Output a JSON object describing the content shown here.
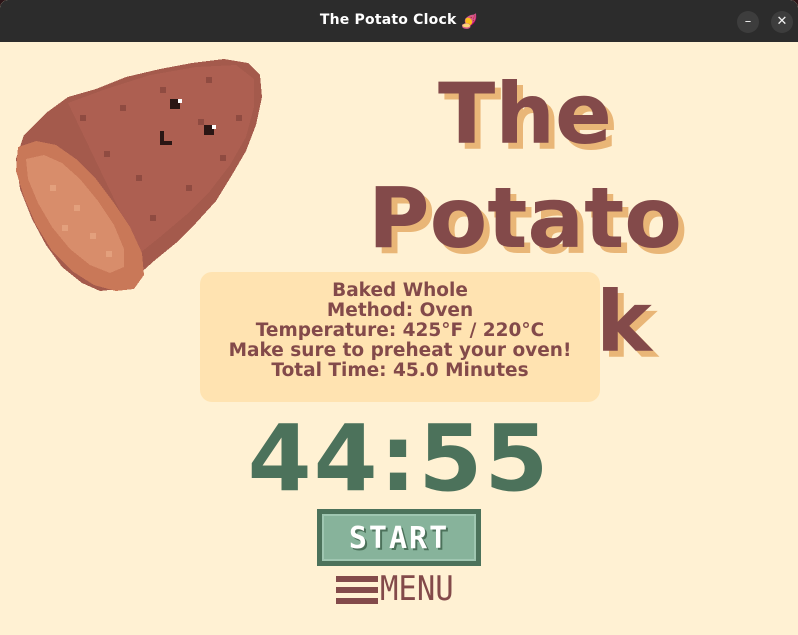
{
  "window": {
    "title": "The Potato Clock",
    "title_emoji": "🍠",
    "minimize_glyph": "–",
    "close_glyph": "✕"
  },
  "header": {
    "title_line1": "The Potato",
    "title_line2": "Clock"
  },
  "recipe": {
    "name": "Baked Whole",
    "method": "Method: Oven",
    "temperature": "Temperature: 425°F / 220°C",
    "tip": "Make sure to preheat your oven!",
    "total_time": "Total Time: 45.0 Minutes"
  },
  "timer": {
    "display": "44:55"
  },
  "controls": {
    "start_label": "START",
    "menu_label": "MENU"
  },
  "icons": {
    "potato": "potato-mascot-icon",
    "menu": "hamburger-menu-icon"
  },
  "colors": {
    "background": "#fff1d3",
    "card": "#ffe3b1",
    "brown_text": "#834a4a",
    "title_shadow": "#e9b677",
    "timer_green": "#4c725b",
    "button_fill": "#87b39b"
  }
}
